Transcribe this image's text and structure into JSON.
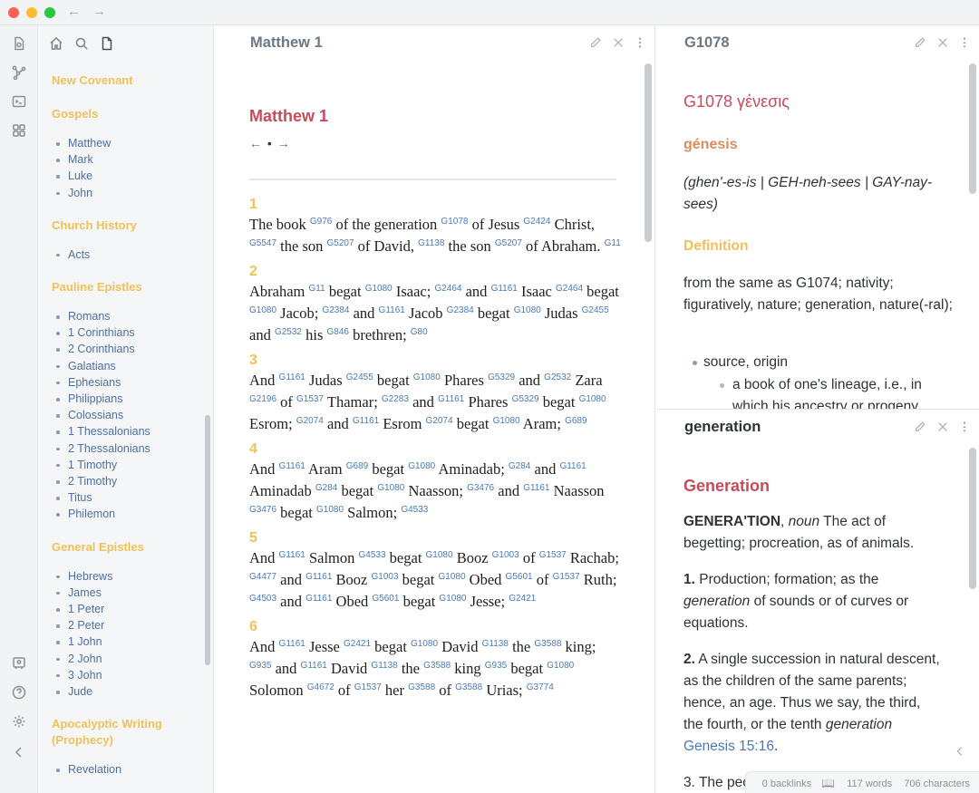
{
  "window": {
    "back_arrow": "←",
    "forward_arrow": "→"
  },
  "ribbon": {
    "icons": [
      "open-note-icon",
      "graph-view-icon",
      "terminal-icon",
      "plugins-icon",
      "vault-icon",
      "help-icon",
      "settings-icon",
      "collapse-icon"
    ]
  },
  "sidebar": {
    "sections": [
      {
        "heading": "New Covenant",
        "items": []
      },
      {
        "heading": "Gospels",
        "items": [
          "Matthew",
          "Mark",
          "Luke",
          "John"
        ]
      },
      {
        "heading": "Church History",
        "items": [
          "Acts"
        ]
      },
      {
        "heading": "Pauline Epistles",
        "items": [
          "Romans",
          "1 Corinthians",
          "2 Corinthians",
          "Galatians",
          "Ephesians",
          "Philippians",
          "Colossians",
          "1 Thessalonians",
          "2 Thessalonians",
          "1 Timothy",
          "2 Timothy",
          "Titus",
          "Philemon"
        ]
      },
      {
        "heading": "General Epistles",
        "items": [
          "Hebrews",
          "James",
          "1 Peter",
          "2 Peter",
          "1 John",
          "2 John",
          "3 John",
          "Jude"
        ]
      },
      {
        "heading": "Apocalyptic Writing (Prophecy)",
        "items": [
          "Revelation"
        ]
      }
    ]
  },
  "middle_pane": {
    "tab_title": "Matthew 1",
    "heading": "Matthew 1",
    "nav": {
      "prev": "←",
      "dot": "•",
      "next": "→"
    },
    "verses": [
      {
        "num": "1",
        "parts": [
          [
            "The book",
            "G976"
          ],
          [
            " of the generation",
            "G1078"
          ],
          [
            " of Jesus",
            "G2424"
          ],
          [
            " Christ,",
            "G5547"
          ],
          [
            " the son",
            "G5207"
          ],
          [
            " of David,",
            "G1138"
          ],
          [
            " the son",
            "G5207"
          ],
          [
            " of Abraham.",
            "G11"
          ]
        ]
      },
      {
        "num": "2",
        "parts": [
          [
            "Abraham",
            "G11"
          ],
          [
            " begat",
            "G1080"
          ],
          [
            " Isaac;",
            "G2464"
          ],
          [
            " and",
            "G1161"
          ],
          [
            " Isaac",
            "G2464"
          ],
          [
            " begat",
            "G1080"
          ],
          [
            " Jacob;",
            "G2384"
          ],
          [
            " and",
            "G1161"
          ],
          [
            " Jacob",
            "G2384"
          ],
          [
            " begat",
            "G1080"
          ],
          [
            " Judas",
            "G2455"
          ],
          [
            " and",
            "G2532"
          ],
          [
            " his",
            "G846"
          ],
          [
            " brethren;",
            "G80"
          ]
        ]
      },
      {
        "num": "3",
        "parts": [
          [
            "And",
            "G1161"
          ],
          [
            " Judas",
            "G2455"
          ],
          [
            " begat",
            "G1080"
          ],
          [
            " Phares",
            "G5329"
          ],
          [
            " and",
            "G2532"
          ],
          [
            " Zara",
            "G2196"
          ],
          [
            " of",
            "G1537"
          ],
          [
            " Thamar;",
            "G2283"
          ],
          [
            " and",
            "G1161"
          ],
          [
            " Phares",
            "G5329"
          ],
          [
            " begat",
            "G1080"
          ],
          [
            " Esrom;",
            "G2074"
          ],
          [
            " and",
            "G1161"
          ],
          [
            " Esrom",
            "G2074"
          ],
          [
            " begat",
            "G1080"
          ],
          [
            " Aram;",
            "G689"
          ]
        ]
      },
      {
        "num": "4",
        "parts": [
          [
            "And",
            "G1161"
          ],
          [
            " Aram",
            "G689"
          ],
          [
            " begat",
            "G1080"
          ],
          [
            " Aminadab;",
            "G284"
          ],
          [
            " and",
            "G1161"
          ],
          [
            " Aminadab",
            "G284"
          ],
          [
            " begat",
            "G1080"
          ],
          [
            " Naasson;",
            "G3476"
          ],
          [
            " and",
            "G1161"
          ],
          [
            " Naasson",
            "G3476"
          ],
          [
            " begat",
            "G1080"
          ],
          [
            " Salmon;",
            "G4533"
          ]
        ]
      },
      {
        "num": "5",
        "parts": [
          [
            "And",
            "G1161"
          ],
          [
            " Salmon",
            "G4533"
          ],
          [
            " begat",
            "G1080"
          ],
          [
            " Booz",
            "G1003"
          ],
          [
            " of",
            "G1537"
          ],
          [
            " Rachab;",
            "G4477"
          ],
          [
            " and",
            "G1161"
          ],
          [
            " Booz",
            "G1003"
          ],
          [
            " begat",
            "G1080"
          ],
          [
            " Obed",
            "G5601"
          ],
          [
            " of",
            "G1537"
          ],
          [
            " Ruth;",
            "G4503"
          ],
          [
            " and",
            "G1161"
          ],
          [
            " Obed",
            "G5601"
          ],
          [
            " begat",
            "G1080"
          ],
          [
            " Jesse;",
            "G2421"
          ]
        ]
      },
      {
        "num": "6",
        "parts": [
          [
            "And",
            "G1161"
          ],
          [
            " Jesse",
            "G2421"
          ],
          [
            " begat",
            "G1080"
          ],
          [
            " David",
            "G1138"
          ],
          [
            " the",
            "G3588"
          ],
          [
            " king;",
            "G935"
          ],
          [
            " and",
            "G1161"
          ],
          [
            " David",
            "G1138"
          ],
          [
            " the",
            "G3588"
          ],
          [
            " king",
            "G935"
          ],
          [
            " begat",
            "G1080"
          ],
          [
            " Solomon",
            "G4672"
          ],
          [
            " of",
            "G1537"
          ],
          [
            " her",
            "G3588"
          ],
          [
            " of",
            "G3588"
          ],
          [
            " Urias;",
            "G3774"
          ]
        ]
      }
    ]
  },
  "right_top_pane": {
    "tab_title": "G1078",
    "heading": "G1078 γένεσις",
    "transliteration": "génesis",
    "pronunciation": "(ghen'-es-is | GEH-neh-sees | GAY-nay-sees)",
    "definition_heading": "Definition",
    "definition": "from the same as G1074; nativity; figuratively, nature; generation, nature(-ral);",
    "list_item": "source, origin",
    "sub_list_item": "a book of one's lineage, i.e., in which his ancestry or progeny"
  },
  "right_bottom_pane": {
    "tab_title": "generation",
    "heading": "Generation",
    "entry_word": "GENERA'TION",
    "entry_pos": "noun",
    "entry_text": " The act of begetting; procreation, as of animals.",
    "def1_num": "1.",
    "def1_a": " Production; formation; as the ",
    "def1_italic": "generation",
    "def1_b": " of sounds or of curves or equations.",
    "def2_num": "2.",
    "def2_a": " A single succession in natural descent, as the children of the same parents; hence, an age. Thus we say, the third, the fourth, or the tenth ",
    "def2_italic": "generation",
    "def2_link": "Genesis 15:16",
    "def2_end": ".",
    "def3_start": "3. The peo"
  },
  "status_bar": {
    "backlinks": "0 backlinks",
    "words": "117 words",
    "characters": "706 characters"
  }
}
